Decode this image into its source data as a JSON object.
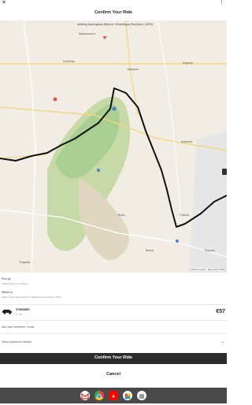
{
  "window": {
    "title": "Confirm Your Ride"
  },
  "map": {
    "destination_label": "Διεθνής Αερολιμένας Αθηνών «Ελευθέριος Βενιζέλος» (ATH)",
    "labels": [
      "Μαρκόπουλο",
      "Χαλάνδρι",
      "Μαρούσι",
      "Κηφισιά",
      "Γλυφάδα",
      "Βάρη",
      "Βούλα",
      "Κορωπί",
      "Παιανία",
      "Ανθούσα"
    ],
    "footer": "©2024 Google · Map data ©2024"
  },
  "pickup": {
    "label": "Pick up",
    "value": "Athens Sector 12, Athens"
  },
  "dropoff": {
    "label": "Where to",
    "value": "Athens International Airport \"Eleftherios Venizelos\" (ATH)"
  },
  "ride": {
    "type": "STANDARD",
    "sub": "1 · 3h",
    "price": "€57"
  },
  "comment_placeholder": "Add your comment / extra",
  "payment_placeholder": "Select payment method",
  "actions": {
    "confirm": "Confirm Your Ride",
    "cancel": "Cancel"
  },
  "dock_icons": [
    "gmail-icon",
    "chrome-icon",
    "youtube-icon",
    "photos-icon",
    "apps-icon"
  ],
  "colors": {
    "route": "#111111",
    "dark_button": "#2b2b2b",
    "park_green": "#a9d39a"
  }
}
